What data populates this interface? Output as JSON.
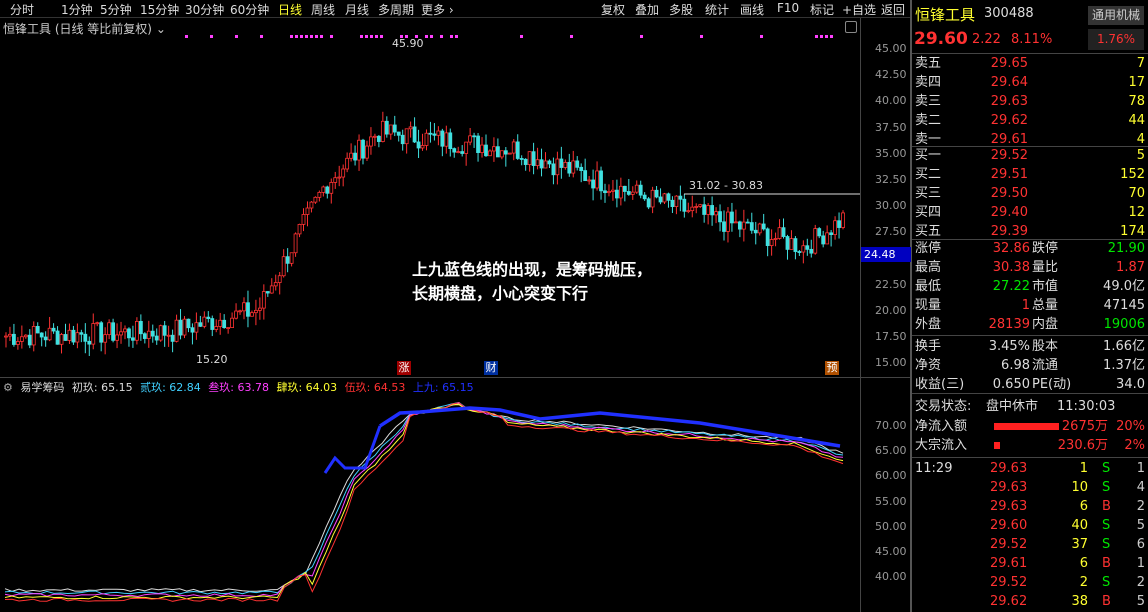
{
  "toolbar": {
    "items": [
      "分时",
      "1分钟",
      "5分钟",
      "15分钟",
      "30分钟",
      "60分钟",
      "日线",
      "周线",
      "月线",
      "多周期",
      "更多 ›",
      "复权",
      "叠加",
      "多股",
      "统计",
      "画线",
      "F10",
      "标记",
      "+自选",
      "返回"
    ],
    "active": "日线"
  },
  "chart_header": "恒锋工具 (日线 等比前复权)",
  "price_axis": [
    "45.00",
    "42.50",
    "40.00",
    "37.50",
    "35.00",
    "32.50",
    "30.00",
    "27.50",
    "25.00",
    "22.50",
    "20.00",
    "17.50",
    "15.00"
  ],
  "current_price_tag": "24.48",
  "high_label": "45.90",
  "low_label": "15.20",
  "range_label": "31.02 - 30.83",
  "markers": [
    {
      "text": "涨",
      "color": "#c00000"
    },
    {
      "text": "财",
      "color": "#0040c0"
    },
    {
      "text": "预",
      "color": "#c06000"
    }
  ],
  "annotation": [
    "上九蓝色线的出现，是筹码抛压，",
    "长期横盘，小心突变下行"
  ],
  "indicator": {
    "name": "易学筹码",
    "lines": [
      {
        "label": "初玖: 65.15",
        "color": "#dddddd"
      },
      {
        "label": "贰玖: 62.84",
        "color": "#40d0ff"
      },
      {
        "label": "叁玖: 63.78",
        "color": "#ff40ff"
      },
      {
        "label": "肆玖: 64.03",
        "color": "#ffff30"
      },
      {
        "label": "伍玖: 64.53",
        "color": "#ff3232"
      },
      {
        "label": "上九: 65.15",
        "color": "#2030ff"
      }
    ],
    "axis": [
      "70.00",
      "65.00",
      "60.00",
      "55.00",
      "50.00",
      "45.00",
      "40.00"
    ]
  },
  "stock": {
    "name": "恒锋工具",
    "code": "300488",
    "sector": "通用机械",
    "price": "29.60",
    "change": "2.22",
    "pct": "8.11%",
    "sector_pct": "1.76%"
  },
  "asks": [
    {
      "label": "卖五",
      "price": "29.65",
      "qty": "7"
    },
    {
      "label": "卖四",
      "price": "29.64",
      "qty": "17"
    },
    {
      "label": "卖三",
      "price": "29.63",
      "qty": "78"
    },
    {
      "label": "卖二",
      "price": "29.62",
      "qty": "44"
    },
    {
      "label": "卖一",
      "price": "29.61",
      "qty": "4"
    }
  ],
  "bids": [
    {
      "label": "买一",
      "price": "29.52",
      "qty": "5"
    },
    {
      "label": "买二",
      "price": "29.51",
      "qty": "152"
    },
    {
      "label": "买三",
      "price": "29.50",
      "qty": "70"
    },
    {
      "label": "买四",
      "price": "29.40",
      "qty": "12"
    },
    {
      "label": "买五",
      "price": "29.39",
      "qty": "174"
    }
  ],
  "stats": [
    {
      "l1": "涨停",
      "v1": "32.86",
      "c1": "red",
      "l2": "跌停",
      "v2": "21.90",
      "c2": "grn"
    },
    {
      "l1": "最高",
      "v1": "30.38",
      "c1": "red",
      "l2": "量比",
      "v2": "1.87",
      "c2": "red"
    },
    {
      "l1": "最低",
      "v1": "27.22",
      "c1": "grn",
      "l2": "市值",
      "v2": "49.0亿",
      "c2": "wht"
    },
    {
      "l1": "现量",
      "v1": "1",
      "c1": "red",
      "l2": "总量",
      "v2": "47145",
      "c2": "wht"
    },
    {
      "l1": "外盘",
      "v1": "28139",
      "c1": "red",
      "l2": "内盘",
      "v2": "19006",
      "c2": "grn"
    },
    {
      "l1": "换手",
      "v1": "3.45%",
      "c1": "wht",
      "l2": "股本",
      "v2": "1.66亿",
      "c2": "wht"
    },
    {
      "l1": "净资",
      "v1": "6.98",
      "c1": "wht",
      "l2": "流通",
      "v2": "1.37亿",
      "c2": "wht"
    },
    {
      "l1": "收益(三)",
      "v1": "0.650",
      "c1": "wht",
      "l2": "PE(动)",
      "v2": "34.0",
      "c2": "wht"
    }
  ],
  "status": {
    "label": "交易状态:",
    "value": "盘中休市",
    "time": "11:30:03"
  },
  "flows": [
    {
      "label": "净流入额",
      "amount": "2675万",
      "pct": "20%",
      "bar": 0.9
    },
    {
      "label": "大宗流入",
      "amount": "230.6万",
      "pct": "2%",
      "bar": 0.08
    }
  ],
  "ticks": [
    {
      "time": "11:29",
      "price": "29.63",
      "vol": "1",
      "side": "S",
      "n": "1"
    },
    {
      "time": "",
      "price": "29.63",
      "vol": "10",
      "side": "S",
      "n": "4"
    },
    {
      "time": "",
      "price": "29.63",
      "vol": "6",
      "side": "B",
      "n": "2"
    },
    {
      "time": "",
      "price": "29.60",
      "vol": "40",
      "side": "S",
      "n": "5"
    },
    {
      "time": "",
      "price": "29.52",
      "vol": "37",
      "side": "S",
      "n": "6"
    },
    {
      "time": "",
      "price": "29.61",
      "vol": "6",
      "side": "B",
      "n": "1"
    },
    {
      "time": "",
      "price": "29.52",
      "vol": "2",
      "side": "S",
      "n": "2"
    },
    {
      "time": "",
      "price": "29.62",
      "vol": "38",
      "side": "B",
      "n": "5"
    }
  ]
}
